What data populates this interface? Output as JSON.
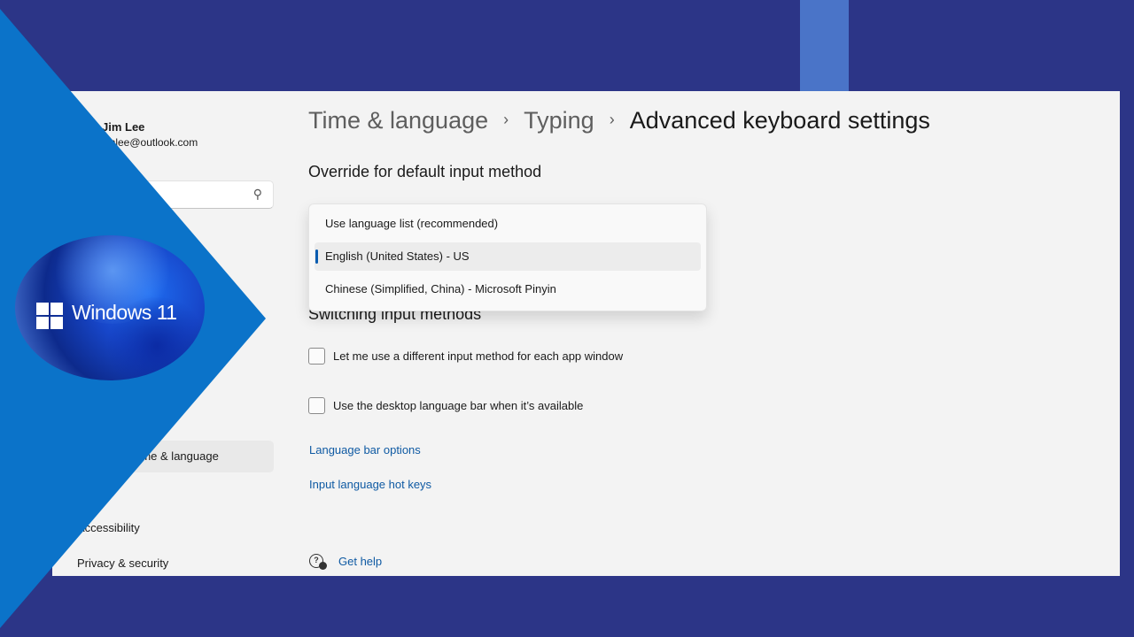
{
  "colors": {
    "page_background": "#2c3587",
    "window_background": "#f3f3f3",
    "link": "#0f5aa3",
    "selection_pill": "#0a5cb0",
    "triangle": "#0b73c9"
  },
  "sidebar": {
    "user_name": "Jim Lee",
    "user_email": "jimlee@outlook.com",
    "search_icon": "search-icon",
    "items": [
      {
        "label": "Time & language",
        "selected": true
      },
      {
        "label": "Accessibility",
        "selected": false
      },
      {
        "label": "Privacy & security",
        "selected": false
      }
    ]
  },
  "main": {
    "breadcrumb": {
      "parent1": "Time & language",
      "parent2": "Typing",
      "current": "Advanced keyboard settings",
      "separator": "›"
    },
    "override_title": "Override for default input method",
    "dropdown": {
      "options": [
        {
          "label": "Use language list (recommended)",
          "selected": false
        },
        {
          "label": "English (United States) - US",
          "selected": true
        },
        {
          "label": "Chinese (Simplified, China) - Microsoft Pinyin",
          "selected": false
        }
      ]
    },
    "switching_title": "Switching input methods",
    "checkboxes": [
      {
        "label": "Let me use a different input method for each app window",
        "checked": false
      },
      {
        "label": "Use the desktop language bar when it’s available",
        "checked": false
      }
    ],
    "links": {
      "language_bar": "Language bar options",
      "hot_keys": "Input language hot keys"
    },
    "help": {
      "label": "Get help",
      "icon": "help-icon"
    }
  },
  "overlay": {
    "logo_text": "Windows 11"
  }
}
